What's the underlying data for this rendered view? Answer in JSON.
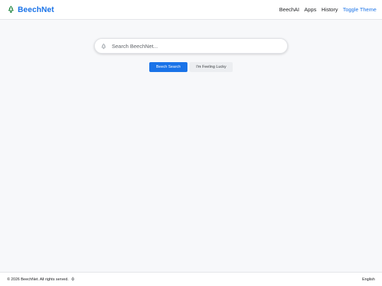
{
  "header": {
    "brand": "BeechNet",
    "brand_icon": "tree-logo-icon",
    "nav": {
      "ai": "BeechAI",
      "apps": "Apps",
      "history": "History",
      "toggle_theme": "Toggle Theme"
    }
  },
  "search": {
    "placeholder": "Search BeechNet...",
    "value": "",
    "icon": "tree-search-icon"
  },
  "buttons": {
    "search": "Beech Search",
    "lucky": "I'm Feeling Lucky"
  },
  "footer": {
    "copyright": "© 2026 BeechNet. All rights served.",
    "icon": "tree-icon",
    "language": "English"
  },
  "colors": {
    "accent": "#1a73e8",
    "logo_green": "#188038",
    "background": "#f7f8fa"
  }
}
